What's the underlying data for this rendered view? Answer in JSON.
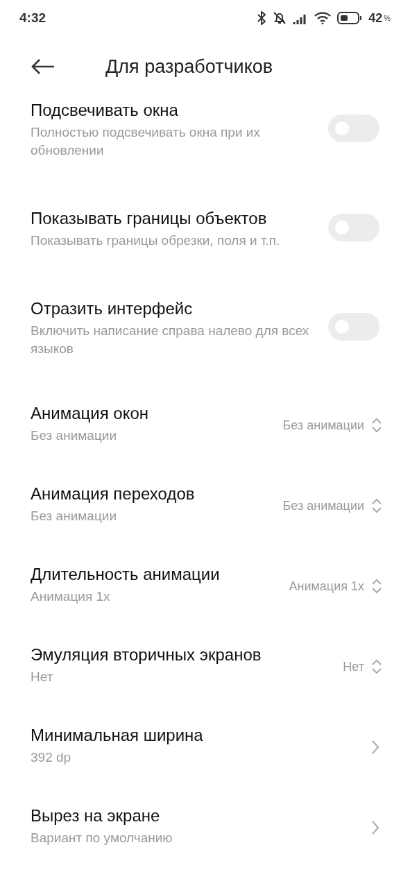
{
  "status_bar": {
    "time": "4:32",
    "battery_percent": "42",
    "percent_sign": "%"
  },
  "header": {
    "title": "Для разработчиков"
  },
  "settings": [
    {
      "kind": "toggle",
      "title": "Подсвечивать окна",
      "subtitle": "Полностью подсвечивать окна при их обновлении",
      "on": false
    },
    {
      "kind": "toggle",
      "title": "Показывать границы объектов",
      "subtitle": "Показывать границы обрезки, поля и т.п.",
      "on": false
    },
    {
      "kind": "toggle",
      "title": "Отразить интерфейс",
      "subtitle": "Включить написание справа налево для всех языков",
      "on": false
    },
    {
      "kind": "select",
      "title": "Анимация окон",
      "subtitle": "Без анимации",
      "value": "Без анимации"
    },
    {
      "kind": "select",
      "title": "Анимация переходов",
      "subtitle": "Без анимации",
      "value": "Без анимации"
    },
    {
      "kind": "select",
      "title": "Длительность анимации",
      "subtitle": "Анимация 1x",
      "value": "Анимация 1x"
    },
    {
      "kind": "select",
      "title": "Эмуляция вторичных экранов",
      "subtitle": "Нет",
      "value": "Нет"
    },
    {
      "kind": "link",
      "title": "Минимальная ширина",
      "subtitle": "392 dp"
    },
    {
      "kind": "link",
      "title": "Вырез на экране",
      "subtitle": "Вариант по умолчанию"
    }
  ]
}
